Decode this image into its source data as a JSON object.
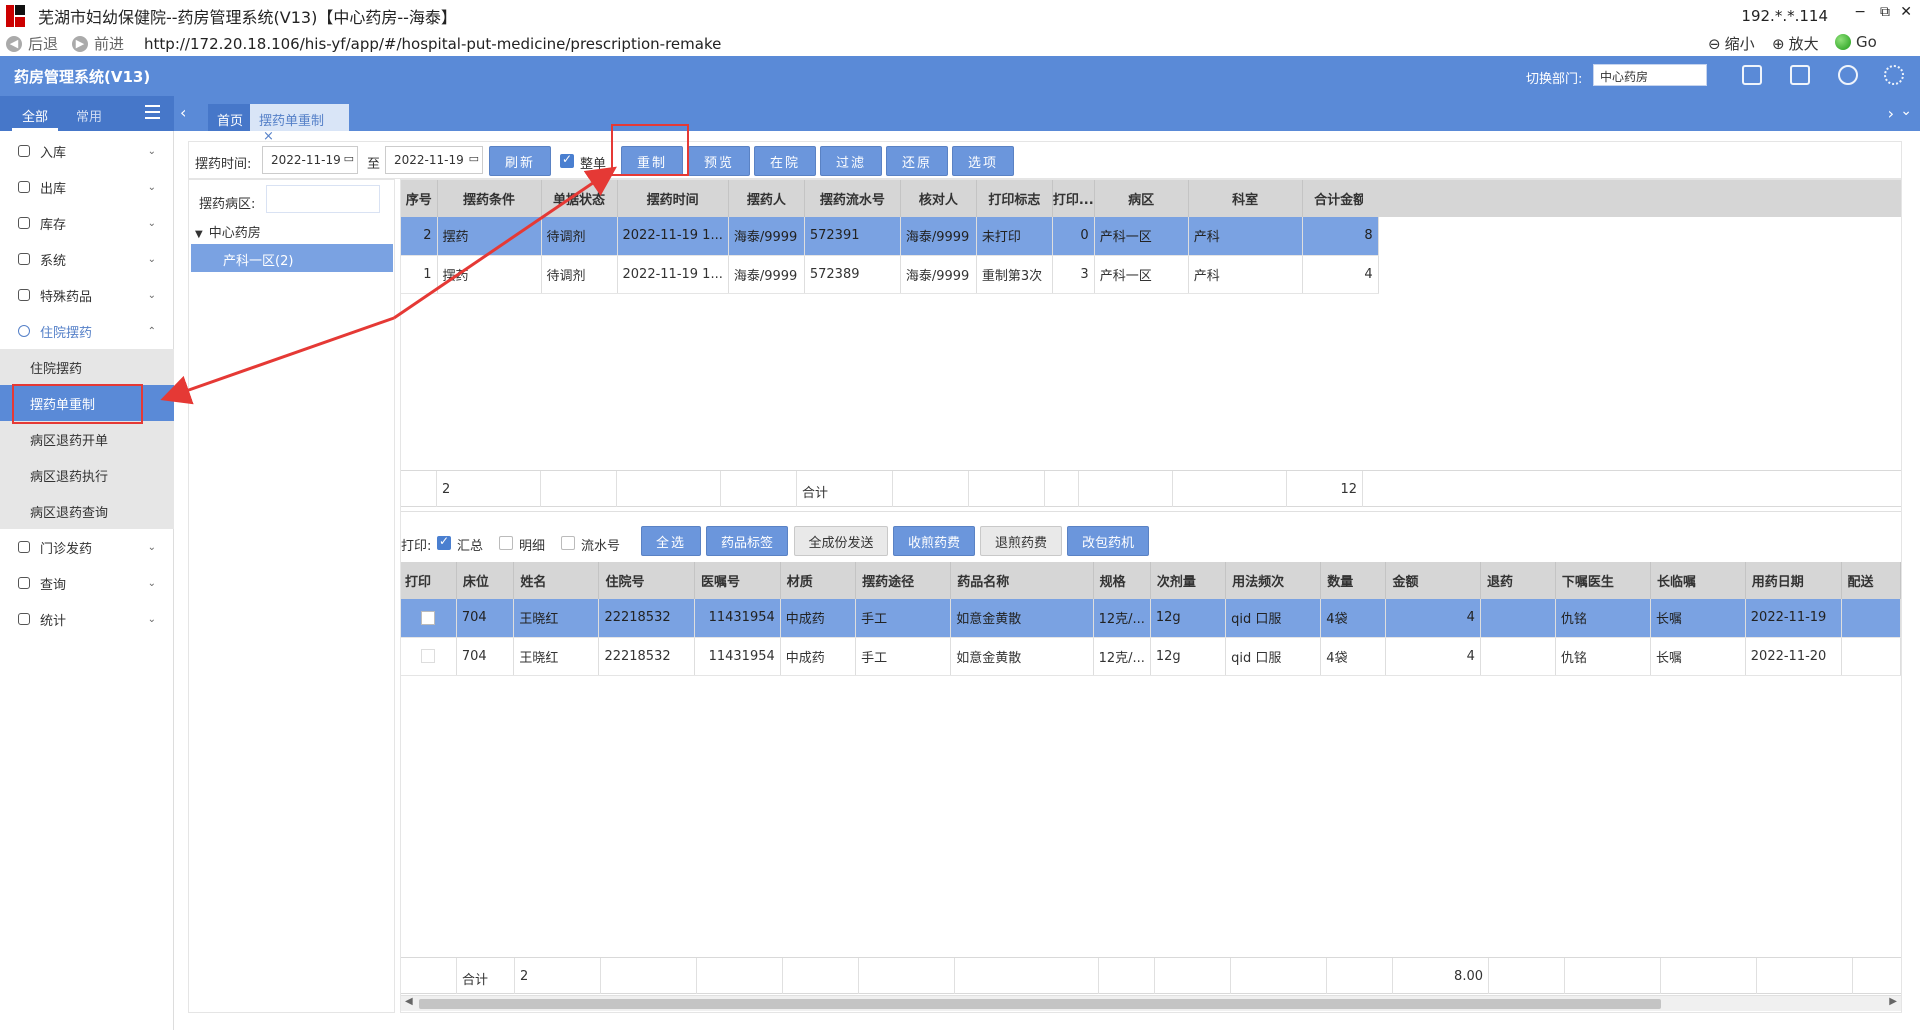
{
  "window": {
    "title": "芜湖市妇幼保健院--药房管理系统(V13)【中心药房--海泰】",
    "ip": "192.*.*.114",
    "min": "−",
    "restore": "⧉",
    "close": "✕"
  },
  "browser": {
    "back": "后退",
    "forward": "前进",
    "url": "http://172.20.18.106/his-yf/app/#/hospital-put-medicine/prescription-remake",
    "zoom_out": "缩小",
    "zoom_in": "放大",
    "go": "Go"
  },
  "header": {
    "app_name": "药房管理系统(V13)",
    "dept_label": "切换部门:",
    "dept_value": "中心药房"
  },
  "sidebar": {
    "tabs": [
      "全部",
      "常用"
    ],
    "items": [
      {
        "label": "入库"
      },
      {
        "label": "出库"
      },
      {
        "label": "库存"
      },
      {
        "label": "系统"
      },
      {
        "label": "特殊药品"
      },
      {
        "label": "住院摆药"
      }
    ],
    "subitems": [
      {
        "label": "住院摆药"
      },
      {
        "label": "摆药单重制"
      },
      {
        "label": "病区退药开单"
      },
      {
        "label": "病区退药执行"
      },
      {
        "label": "病区退药查询"
      }
    ],
    "items_after": [
      {
        "label": "门诊发药"
      },
      {
        "label": "查询"
      },
      {
        "label": "统计"
      }
    ]
  },
  "tabs": {
    "home": "首页",
    "active": "摆药单重制",
    "close": "×"
  },
  "toolbar": {
    "time_label": "摆药时间:",
    "date_from": "2022-11-19",
    "to_label": "至",
    "date_to": "2022-11-19",
    "refresh": "刷新",
    "whole_label": "整单",
    "remake": "重制",
    "preview": "预览",
    "inpatient": "在院",
    "filter": "过滤",
    "restore": "还原",
    "options": "选项"
  },
  "left": {
    "ward_label": "摆药病区:",
    "tree_root": "中心药房",
    "tree_node": "产科一区(2)"
  },
  "upper_table": {
    "headers": [
      "序号",
      "摆药条件",
      "单据状态",
      "摆药时间",
      "摆药人",
      "摆药流水号",
      "核对人",
      "打印标志",
      "打印...",
      "病区",
      "科室",
      "合计金额"
    ],
    "rows": [
      [
        "2",
        "摆药",
        "待调剂",
        "2022-11-19 1...",
        "海泰/9999",
        "572391",
        "海泰/9999",
        "未打印",
        "0",
        "产科一区",
        "产科",
        "8"
      ],
      [
        "1",
        "摆药",
        "待调剂",
        "2022-11-19 1...",
        "海泰/9999",
        "572389",
        "海泰/9999",
        "重制第3次",
        "3",
        "产科一区",
        "产科",
        "4"
      ]
    ],
    "footer": {
      "count": "2",
      "sum_label": "合计",
      "total": "12"
    }
  },
  "print_bar": {
    "label": "打印:",
    "summary": "汇总",
    "detail": "明细",
    "serial": "流水号",
    "select_all": "全选",
    "drug_label": "药品标签",
    "send_all": "全成份发送",
    "collect_fee": "收煎药费",
    "refund_fee": "退煎药费",
    "packer": "改包药机"
  },
  "lower_table": {
    "headers": [
      "打印",
      "床位",
      "姓名",
      "住院号",
      "医嘱号",
      "材质",
      "摆药途径",
      "药品名称",
      "规格",
      "次剂量",
      "用法频次",
      "数量",
      "金额",
      "退药",
      "下嘱医生",
      "长临嘱",
      "用药日期",
      "配送"
    ],
    "rows": [
      [
        "",
        "704",
        "王晓红",
        "22218532",
        "11431954",
        "中成药",
        "手工",
        "如意金黄散",
        "12克/...",
        "12g",
        "qid 口服",
        "4袋",
        "4",
        "",
        "仇铭",
        "长嘱",
        "2022-11-19",
        ""
      ],
      [
        "",
        "704",
        "王晓红",
        "22218532",
        "11431954",
        "中成药",
        "手工",
        "如意金黄散",
        "12克/...",
        "12g",
        "qid 口服",
        "4袋",
        "4",
        "",
        "仇铭",
        "长嘱",
        "2022-11-20",
        ""
      ]
    ],
    "footer": {
      "sum_label": "合计",
      "count": "2",
      "amount": "8.00"
    }
  },
  "colors": {
    "accent": "#5a8ad7",
    "selected_row": "#7aa2e2",
    "annotation": "#e53935"
  }
}
